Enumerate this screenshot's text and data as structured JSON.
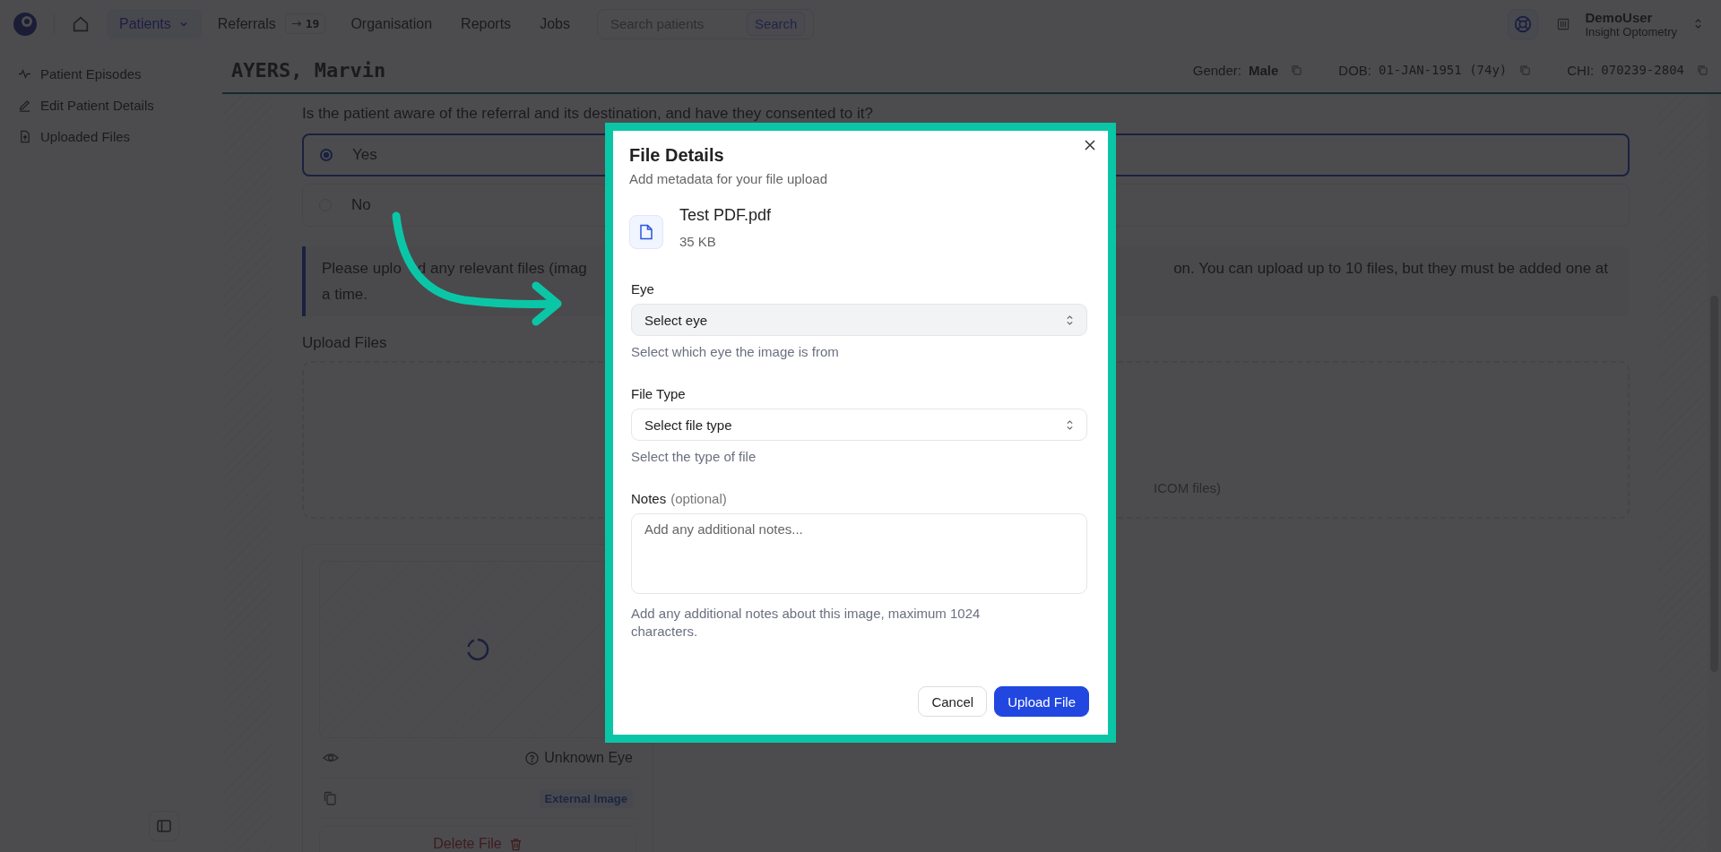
{
  "nav": {
    "items": [
      {
        "label": "Patients",
        "selected": true,
        "dropdown": true
      },
      {
        "label": "Referrals",
        "selected": false,
        "badge": "19"
      },
      {
        "label": "Organisation",
        "selected": false
      },
      {
        "label": "Reports",
        "selected": false
      },
      {
        "label": "Jobs",
        "selected": false
      }
    ],
    "search": {
      "placeholder": "Search patients",
      "button": "Search"
    },
    "user": {
      "name": "DemoUser",
      "organisation": "Insight Optometry"
    }
  },
  "sidebar": {
    "items": [
      {
        "label": "Patient Episodes"
      },
      {
        "label": "Edit Patient Details"
      },
      {
        "label": "Uploaded Files"
      }
    ]
  },
  "patient": {
    "name": "AYERS, Marvin",
    "fields": [
      {
        "label": "Gender:",
        "value": "Male"
      },
      {
        "label": "DOB:",
        "value": "01-JAN-1951 (74y)"
      },
      {
        "label": "CHI:",
        "value": "070239-2804"
      }
    ]
  },
  "question": {
    "text": "Is the patient aware of the referral and its destination, and have they consented to it?",
    "options": [
      {
        "label": "Yes",
        "selected": true
      },
      {
        "label": "No",
        "selected": false
      }
    ]
  },
  "info": {
    "left_a": "Please uplo",
    "left_b": "d any relevant files (imag",
    "right": "on. You can upload up to 10 files, but they must be added one at",
    "line2": "a time."
  },
  "upload": {
    "title": "Upload Files",
    "hint_fragment": "ICOM files)"
  },
  "file_card": {
    "eye": "Unknown Eye",
    "badge": "External Image",
    "delete": "Delete File"
  },
  "modal": {
    "title": "File Details",
    "subtitle": "Add metadata for your file upload",
    "file": {
      "name": "Test PDF.pdf",
      "size": "35 KB"
    },
    "fields": [
      {
        "kind": "select",
        "label": "Eye",
        "placeholder": "Select eye",
        "hint": "Select which eye the image is from",
        "focused": true
      },
      {
        "kind": "select",
        "label": "File Type",
        "placeholder": "Select file type",
        "hint": "Select the type of file",
        "focused": false
      },
      {
        "kind": "textarea",
        "label": "Notes",
        "label_suffix": "(optional)",
        "placeholder": "Add any additional notes...",
        "hint": "Add any additional notes about this image, maximum 1024 characters.",
        "focused": false
      }
    ],
    "buttons": [
      {
        "label": "Cancel",
        "kind": "secondary"
      },
      {
        "label": "Upload File",
        "kind": "primary"
      }
    ]
  }
}
